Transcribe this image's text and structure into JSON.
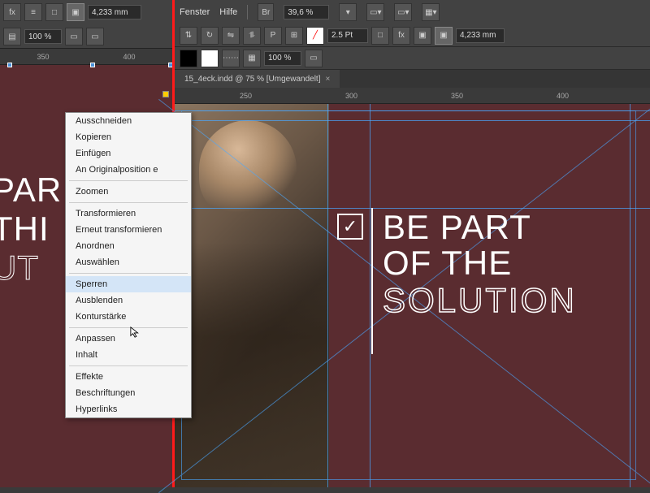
{
  "left_toolbar": {
    "zoom_pct": "100 %",
    "dim_field": "4,233 mm",
    "ruler_ticks": [
      "350",
      "400"
    ]
  },
  "menu": {
    "fenster": "Fenster",
    "hilfe": "Hilfe",
    "br": "Br",
    "zoom": "39,6 %"
  },
  "right_toolbar": {
    "stroke_pt": "2.5 Pt",
    "zoom_pct": "100 %",
    "dim_field": "4,233 mm"
  },
  "doc_tab": {
    "title": "15_4eck.indd @ 75 % [Umgewandelt]",
    "close": "×"
  },
  "right_ruler": [
    "250",
    "300",
    "350",
    "400"
  ],
  "headline": {
    "line1": "BE PART",
    "line2": "OF THE",
    "line3": "SOLUTION"
  },
  "left_headline": {
    "line1": "PAR",
    "line2": "THI",
    "line3": "UT"
  },
  "checkmark": "✓",
  "context_menu": {
    "groups": [
      [
        "Ausschneiden",
        "Kopieren",
        "Einfügen",
        "An Originalposition e"
      ],
      [
        "Zoomen"
      ],
      [
        "Transformieren",
        "Erneut transformieren",
        "Anordnen",
        "Auswählen"
      ],
      [
        "Sperren",
        "Ausblenden",
        "Konturstärke"
      ],
      [
        "Anpassen",
        "Inhalt"
      ],
      [
        "Effekte",
        "Beschriftungen",
        "Hyperlinks"
      ]
    ],
    "hovered": "Sperren"
  }
}
